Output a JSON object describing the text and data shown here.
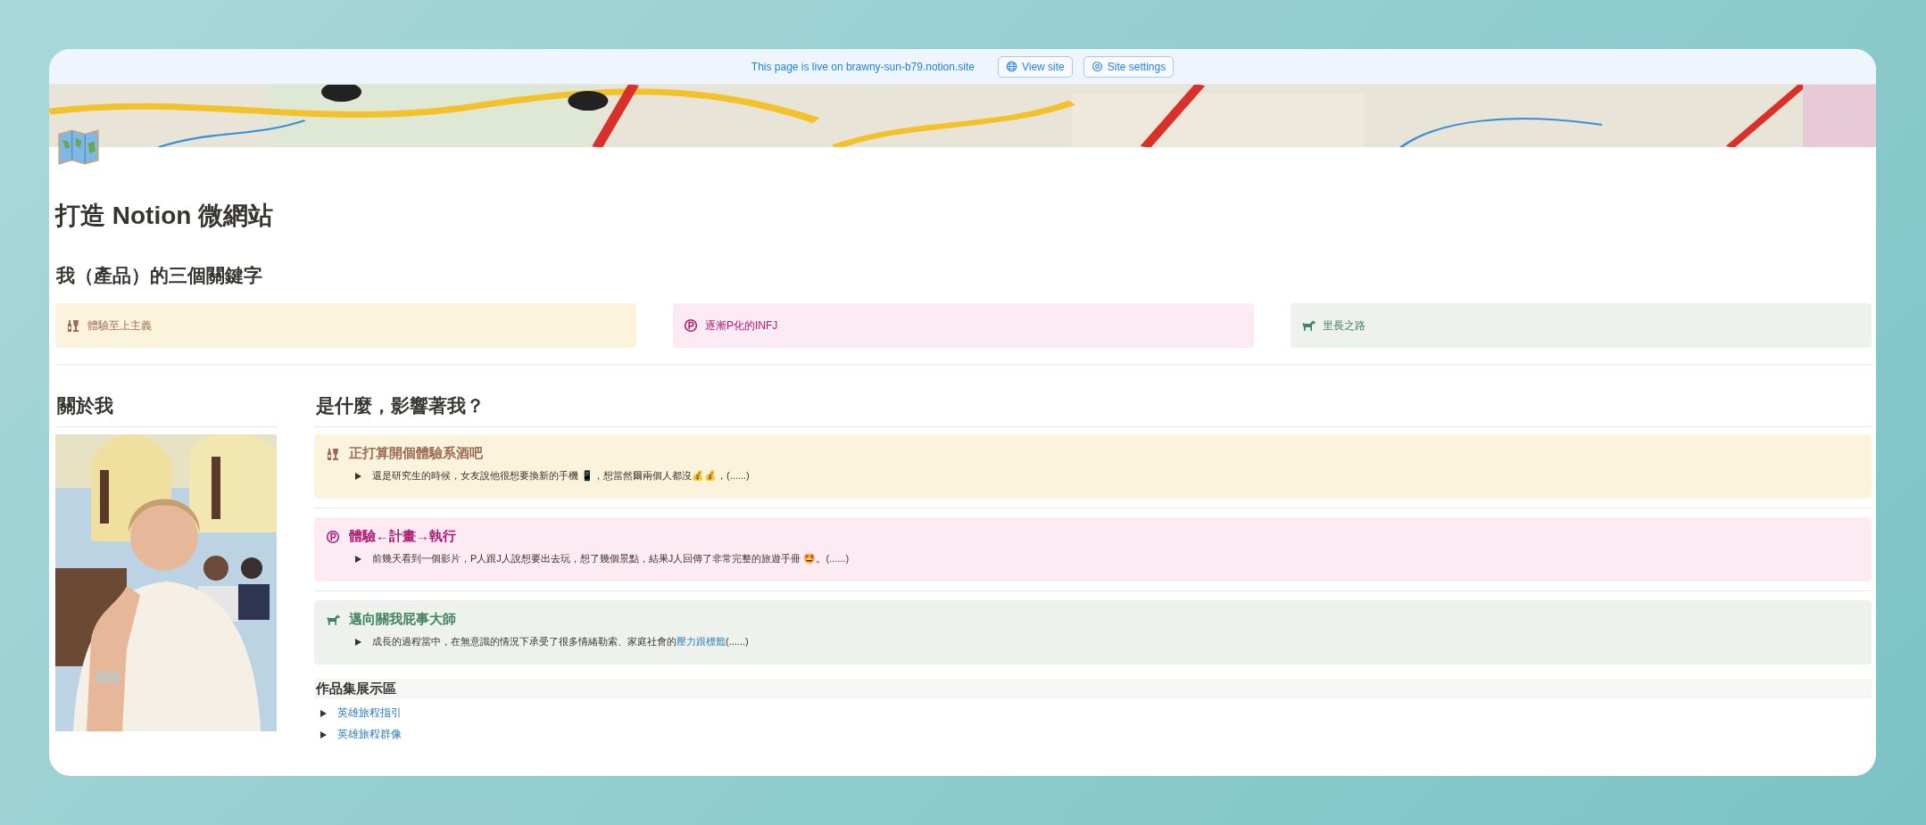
{
  "banner": {
    "text": "This page is live on brawny-sun-b79.notion.site",
    "buttons": [
      {
        "label": "View site",
        "kind": "globe"
      },
      {
        "label": "Site settings",
        "kind": "gear"
      }
    ]
  },
  "page": {
    "title": "打造 Notion 微網站"
  },
  "keywords": {
    "heading": "我（產品）的三個關鍵字",
    "callouts": [
      {
        "text": "體驗至上主義",
        "kind": "bottle",
        "color": "#9f6b53"
      },
      {
        "text": "逐漸P化的INFJ",
        "kind": "parking",
        "color": "#ad1a72"
      },
      {
        "text": "里長之路",
        "kind": "horse",
        "color": "#448361"
      }
    ]
  },
  "about": {
    "heading": "關於我"
  },
  "influences": {
    "heading": "是什麼，影響著我？",
    "callouts": [
      {
        "title": "正打算開個體驗系酒吧",
        "kind": "bottle",
        "color": "#9f6b53",
        "toggle": {
          "expanded": false,
          "segments": [
            {
              "kind": "text",
              "text": "還是研究生的時候，女友說他很想要換新的手機 📱，想當然爾兩個人都沒💰💰，(......)"
            }
          ]
        }
      },
      {
        "title": "體驗←計畫→執行",
        "kind": "parking",
        "color": "#ad1a72",
        "toggle": {
          "expanded": false,
          "segments": [
            {
              "kind": "text",
              "text": "前幾天看到一個影片，P人跟J人說想要出去玩，想了幾個景點，結果J人回傳了非常完整的旅遊手冊 🤩。(......)"
            }
          ]
        }
      },
      {
        "title": "邁向關我屁事大師",
        "kind": "horse",
        "color": "#448361",
        "toggle": {
          "expanded": false,
          "segments": [
            {
              "kind": "text",
              "text": "成長的過程當中，在無意識的情況下承受了很多情緒勒索、家庭社會的"
            },
            {
              "kind": "link",
              "text": "壓力跟標籤"
            },
            {
              "kind": "text",
              "text": "(......)"
            }
          ]
        }
      }
    ]
  },
  "portfolio": {
    "heading": "作品集展示區",
    "items": [
      {
        "text": "英雄旅程指引",
        "expanded": false
      },
      {
        "text": "英雄旅程群像",
        "expanded": false
      }
    ]
  }
}
